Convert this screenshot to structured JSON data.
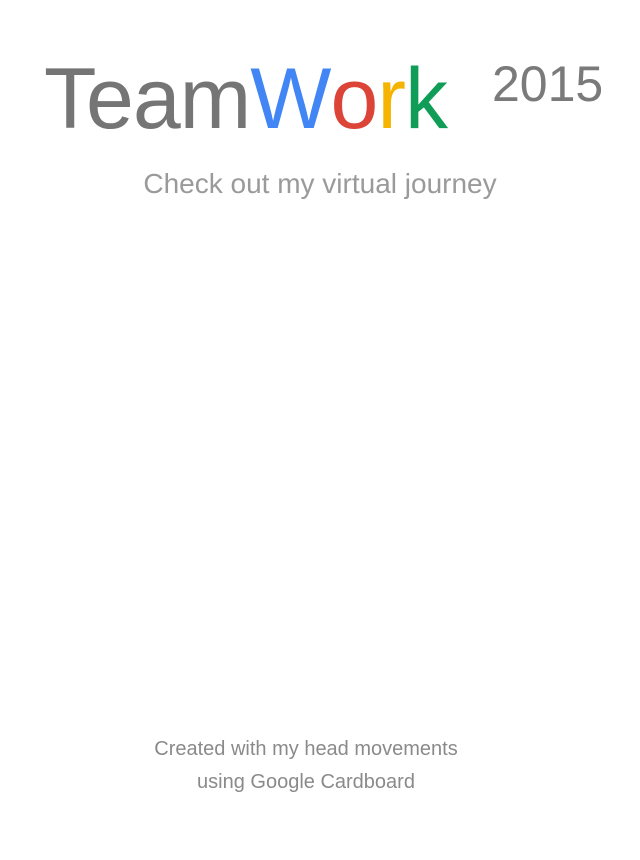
{
  "title": {
    "part1": "Team",
    "letters": [
      {
        "char": "W",
        "color": "#4285F4"
      },
      {
        "char": "o",
        "color": "#DB4437"
      },
      {
        "char": "r",
        "color": "#F4B400"
      },
      {
        "char": "k",
        "color": "#0F9D58"
      }
    ],
    "year": "2015"
  },
  "subtitle": "Check out my virtual journey",
  "footer": {
    "line1": "Created with my head movements",
    "line2": "using Google Cardboard"
  }
}
